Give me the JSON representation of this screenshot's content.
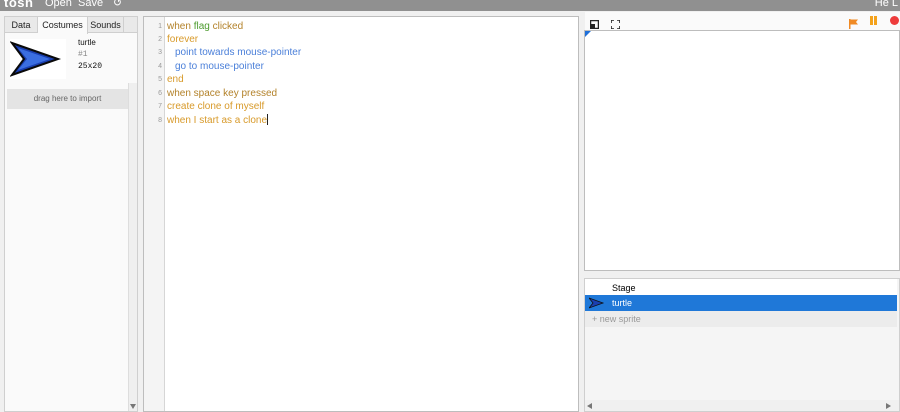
{
  "app": {
    "logo": "tosh",
    "menu": {
      "open": "Open",
      "save": "Save",
      "undo": "↺"
    },
    "user": "He L"
  },
  "left_panel": {
    "tabs": {
      "data": "Data",
      "costumes": "Costumes",
      "sounds": "Sounds"
    },
    "active_tab": "Costumes",
    "costume": {
      "name": "turtle",
      "number": "#1",
      "size": "25x20"
    },
    "import_hint": "drag here to import"
  },
  "code": {
    "lines": [
      {
        "n": "1",
        "text": "when flag clicked"
      },
      {
        "n": "2",
        "text": "forever"
      },
      {
        "n": "3",
        "text": "point towards mouse-pointer"
      },
      {
        "n": "4",
        "text": "go to mouse-pointer"
      },
      {
        "n": "5",
        "text": "end"
      },
      {
        "n": "6",
        "text": "when space key pressed"
      },
      {
        "n": "7",
        "text": "create clone of myself"
      },
      {
        "n": "8",
        "text": "when I start as a clone"
      }
    ]
  },
  "stage_controls": {
    "icons": [
      "small-stage-icon",
      "fullscreen-icon",
      "green-flag-icon",
      "pause-icon",
      "stop-icon"
    ],
    "colors": {
      "flag": "#f08a24",
      "pause": "#f4a21b",
      "stop": "#ee3c3c"
    }
  },
  "sprites": {
    "stage_label": "Stage",
    "items": [
      {
        "name": "turtle",
        "selected": true
      }
    ],
    "new_sprite": "+ new sprite",
    "selected_color": "#1f78d8"
  }
}
